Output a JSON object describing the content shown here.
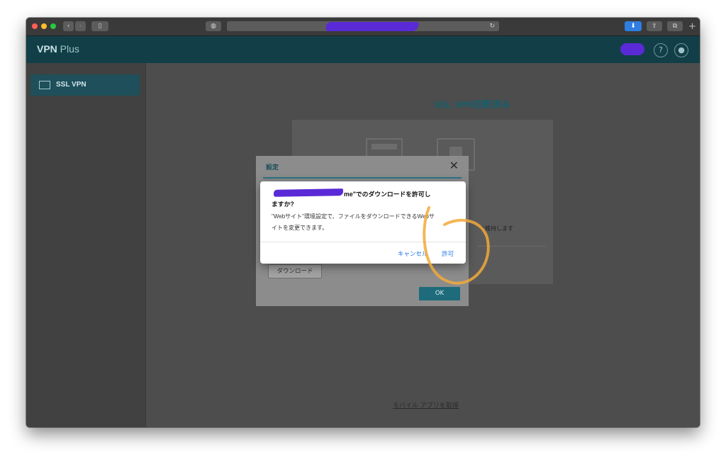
{
  "browser": {
    "nav_back": "‹",
    "nav_forward": "›",
    "sidebar_icon": "▯",
    "privacy_icon": "◍",
    "reload_icon": "↻",
    "download_icon": "⬇",
    "share_icon": "⇪",
    "tabs_icon": "⧉",
    "new_tab": "+"
  },
  "app": {
    "brand_bold": "VPN",
    "brand_rest": " Plus",
    "help_icon": "?",
    "account_icon": "●"
  },
  "sidebar": {
    "items": [
      {
        "label": "SSL VPN",
        "icon": "network-icon"
      }
    ]
  },
  "main": {
    "status_title": "SSL VPN切断済み",
    "keep_text": "を維持します",
    "mobile_link": "モバイル アプリを取得"
  },
  "settings_dialog": {
    "title": "設定",
    "close": "✕",
    "download_label": "ダウンロード",
    "ok_label": "OK"
  },
  "alert": {
    "title_line1": "me\"でのダウンロードを許可し",
    "title_line2": "ますか?",
    "message_line1": "\"Webサイト\"環境設定で、ファイルをダウンロードできるWebサ",
    "message_line2": "イトを変更できます。",
    "cancel_label": "キャンセル",
    "allow_label": "許可"
  },
  "colors": {
    "header_bg": "#123f47",
    "accent": "#1d6b7b",
    "link_blue": "#1a73e8",
    "annotation_orange": "#f2a93b",
    "redaction_purple": "#5a2ad6"
  }
}
